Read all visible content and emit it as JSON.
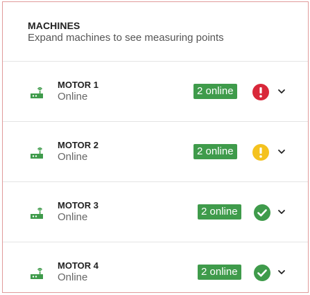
{
  "header": {
    "title": "MACHINES",
    "subtitle": "Expand machines to see measuring points"
  },
  "colors": {
    "online_badge": "#3f9b4b",
    "alarm_red": "#d9283a",
    "warning_yellow": "#f4c21e",
    "ok_green": "#3f9b4b"
  },
  "machines": [
    {
      "name": "MOTOR 1",
      "status": "Online",
      "badge": "2 online",
      "alert_icon": "exclamation-red-icon"
    },
    {
      "name": "MOTOR 2",
      "status": "Online",
      "badge": "2 online",
      "alert_icon": "exclamation-yellow-icon"
    },
    {
      "name": "MOTOR 3",
      "status": "Online",
      "badge": "2 online",
      "alert_icon": "check-green-icon"
    },
    {
      "name": "MOTOR 4",
      "status": "Online",
      "badge": "2 online",
      "alert_icon": "check-green-icon"
    }
  ]
}
